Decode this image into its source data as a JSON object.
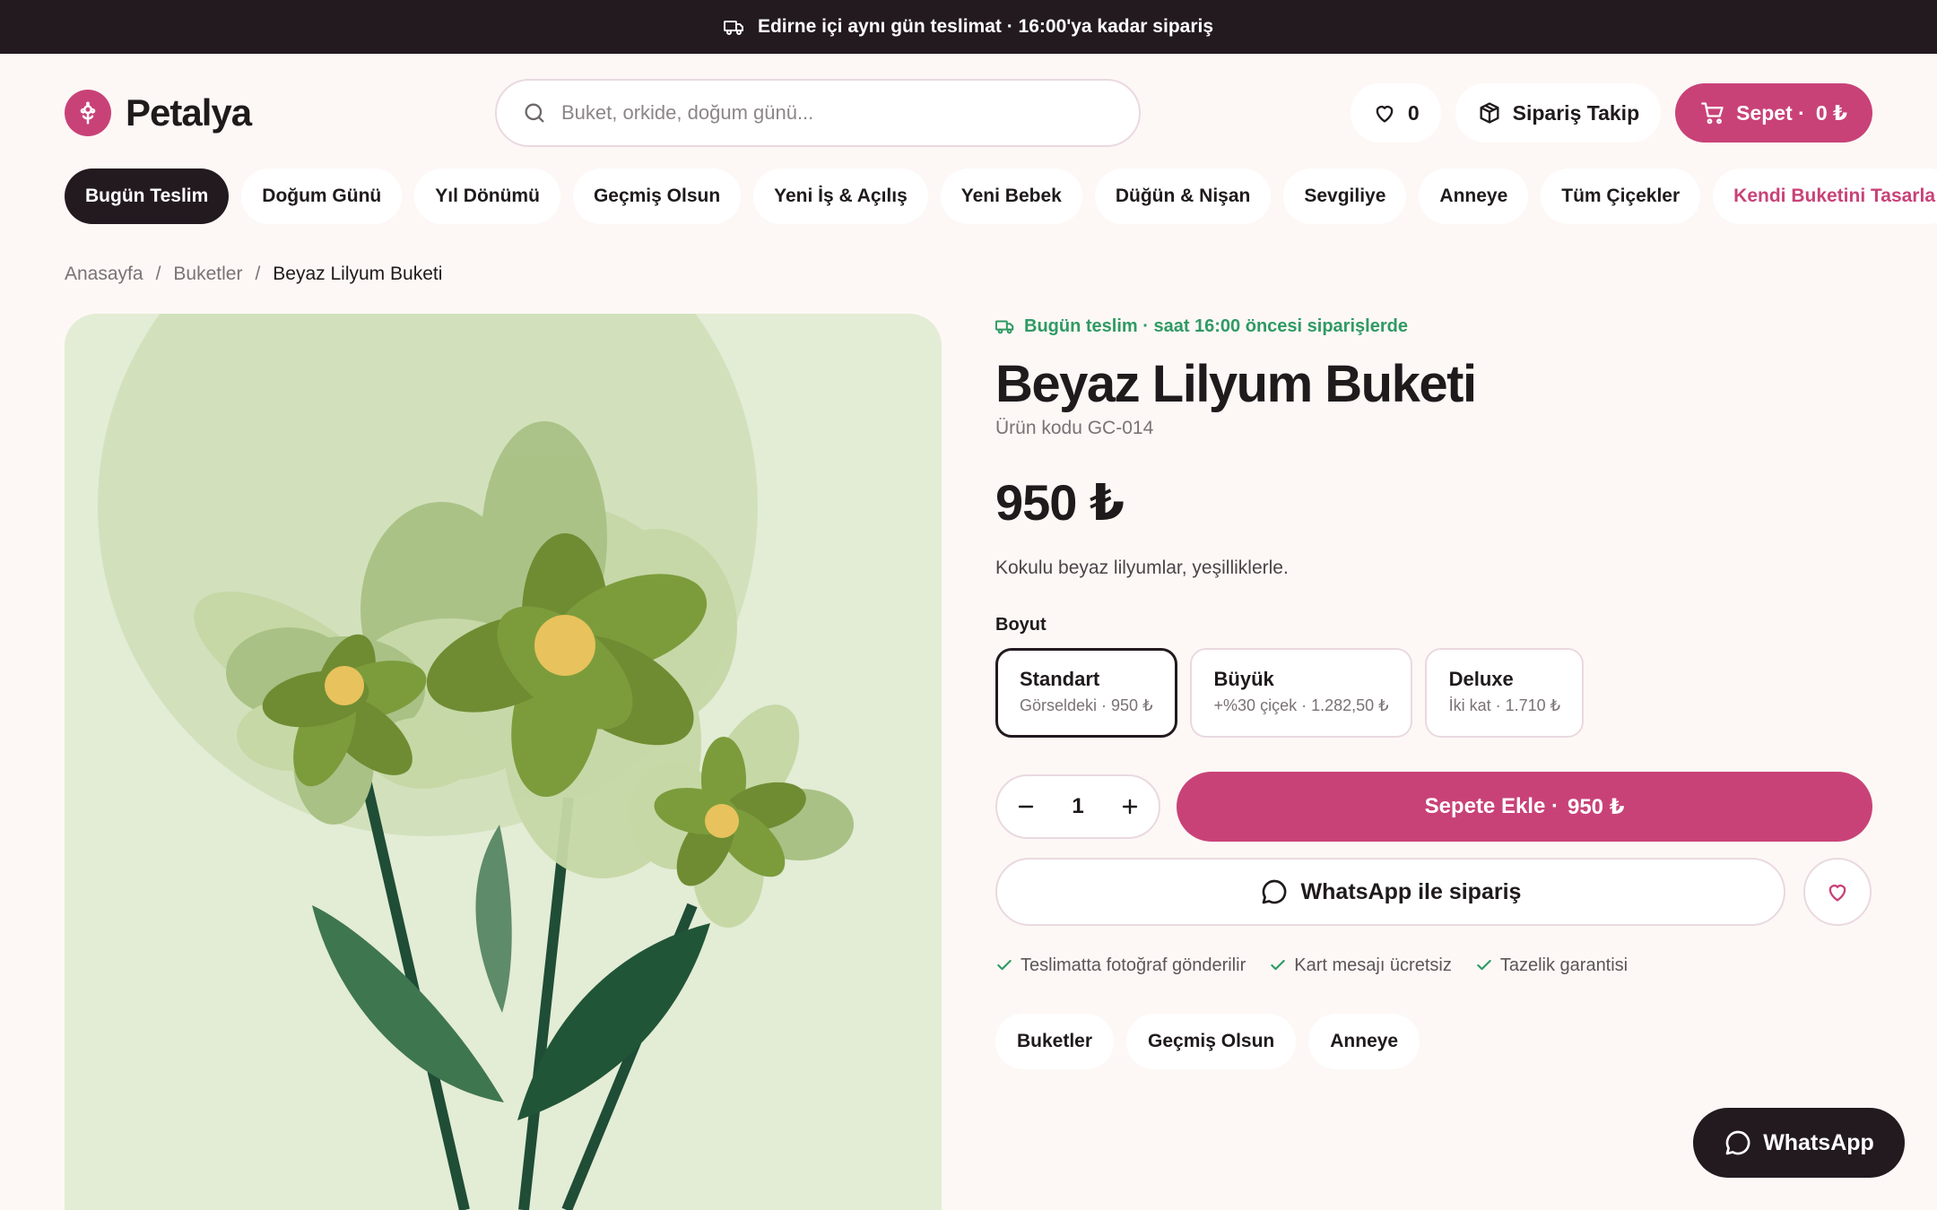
{
  "topbar": {
    "text": "Edirne içi aynı gün teslimat · 16:00'ya kadar sipariş",
    "icon": "truck-icon"
  },
  "brand": {
    "name": "Petalya",
    "color": "#c84278",
    "icon": "flower-icon"
  },
  "search": {
    "placeholder": "Buket, orkide, doğum günü..."
  },
  "header": {
    "favorites_count": "0",
    "order_tracking": "Sipariş Takip",
    "cart_label": "Sepet ·",
    "cart_total": "0 ₺"
  },
  "categories": [
    {
      "label": "Bugün Teslim"
    },
    {
      "label": "Doğum Günü"
    },
    {
      "label": "Yıl Dönümü"
    },
    {
      "label": "Geçmiş Olsun"
    },
    {
      "label": "Yeni İş & Açılış"
    },
    {
      "label": "Yeni Bebek"
    },
    {
      "label": "Düğün & Nişan"
    },
    {
      "label": "Sevgiliye"
    },
    {
      "label": "Anneye"
    },
    {
      "label": "Tüm Çiçekler"
    },
    {
      "label": "Kendi Buketini Tasarla"
    }
  ],
  "breadcrumb": {
    "home": "Anasayfa",
    "section": "Buketler",
    "current": "Beyaz Lilyum Buketi"
  },
  "product": {
    "delivery_note": "Bugün teslim · saat 16:00 öncesi siparişlerde",
    "title": "Beyaz Lilyum Buketi",
    "sku": "Ürün kodu GC-014",
    "price": "950 ₺",
    "description": "Kokulu beyaz lilyumlar, yeşilliklerle.",
    "size_label": "Boyut",
    "sizes": [
      {
        "name": "Standart",
        "sub": "Görseldeki · 950 ₺",
        "selected": true
      },
      {
        "name": "Büyük",
        "sub": "+%30 çiçek · 1.282,50 ₺",
        "selected": false
      },
      {
        "name": "Deluxe",
        "sub": "İki kat · 1.710 ₺",
        "selected": false
      }
    ],
    "quantity": "1",
    "add_to_cart": "Sepete Ekle ·",
    "add_to_cart_price": "950 ₺",
    "whatsapp_order": "WhatsApp ile sipariş",
    "perks": [
      "Teslimatta fotoğraf gönderilir",
      "Kart mesajı ücretsiz",
      "Tazelik garantisi"
    ],
    "tags": [
      "Buketler",
      "Geçmiş Olsun",
      "Anneye"
    ]
  },
  "float_whatsapp": "WhatsApp",
  "colors": {
    "accent": "#c84278",
    "dark": "#231a20",
    "success": "#2f9a64",
    "background": "#fdf8f5"
  }
}
